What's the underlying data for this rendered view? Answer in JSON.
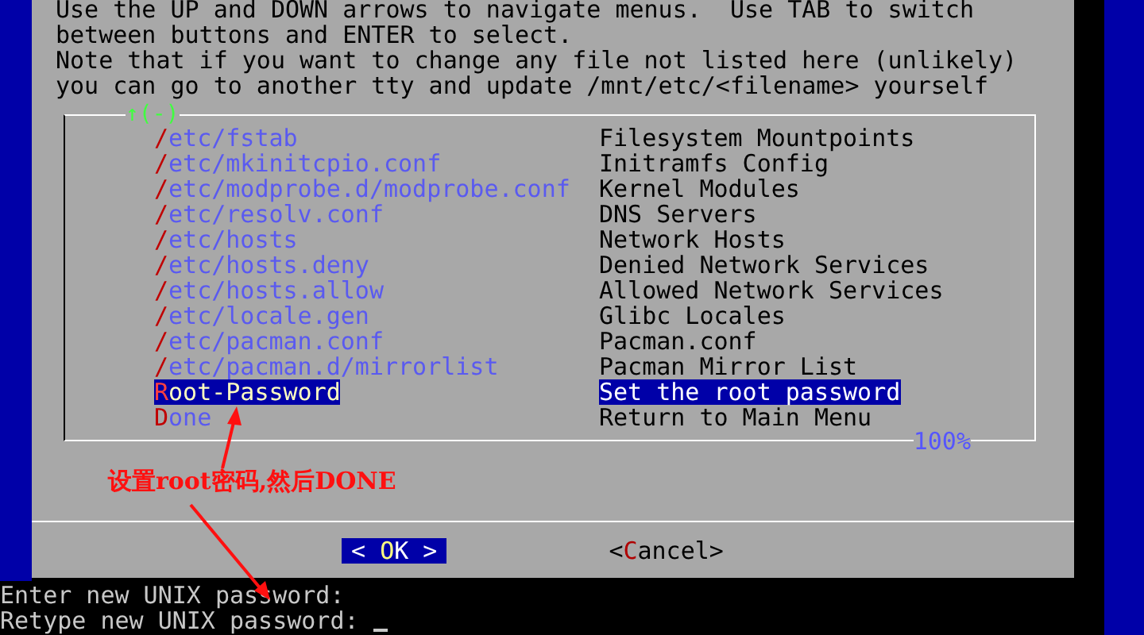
{
  "instructions": [
    "Use the UP and DOWN arrows to navigate menus.  Use TAB to switch",
    "between buttons and ENTER to select.",
    "Note that if you want to change any file not listed here (unlikely)",
    "you can go to another tty and update /mnt/etc/<filename> yourself"
  ],
  "menu": {
    "scroll_indicator": "↑(-)",
    "percent": "100%",
    "items": [
      {
        "tag": "/etc/fstab",
        "description": "Filesystem Mountpoints",
        "selected": false
      },
      {
        "tag": "/etc/mkinitcpio.conf",
        "description": "Initramfs Config",
        "selected": false
      },
      {
        "tag": "/etc/modprobe.d/modprobe.conf",
        "description": "Kernel Modules",
        "selected": false
      },
      {
        "tag": "/etc/resolv.conf",
        "description": "DNS Servers",
        "selected": false
      },
      {
        "tag": "/etc/hosts",
        "description": "Network Hosts",
        "selected": false
      },
      {
        "tag": "/etc/hosts.deny",
        "description": "Denied Network Services",
        "selected": false
      },
      {
        "tag": "/etc/hosts.allow",
        "description": "Allowed Network Services",
        "selected": false
      },
      {
        "tag": "/etc/locale.gen",
        "description": "Glibc Locales",
        "selected": false
      },
      {
        "tag": "/etc/pacman.conf",
        "description": "Pacman.conf",
        "selected": false
      },
      {
        "tag": "/etc/pacman.d/mirrorlist",
        "description": "Pacman Mirror List",
        "selected": false
      },
      {
        "tag": "Root-Password",
        "description": "Set the root password",
        "selected": true
      },
      {
        "tag": "Done",
        "description": "Return to Main Menu",
        "selected": false
      }
    ]
  },
  "annotation": {
    "text": "设置root密码,然后DONE"
  },
  "buttons": [
    {
      "open": "<",
      "label": "OK",
      "close": ">",
      "selected": true
    },
    {
      "open": "<",
      "label": "Cancel",
      "close": ">",
      "selected": false
    }
  ],
  "terminal": {
    "lines": [
      "Enter new UNIX password:",
      "Retype new UNIX password:"
    ]
  }
}
